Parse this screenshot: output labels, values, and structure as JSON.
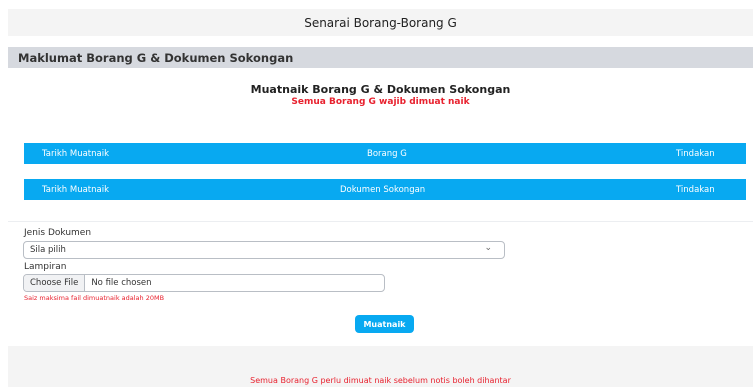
{
  "header": {
    "title": "Senarai Borang-Borang G"
  },
  "section": {
    "title": "Maklumat Borang G & Dokumen Sokongan"
  },
  "upload": {
    "title": "Muatnaik Borang G & Dokumen Sokongan",
    "subtitle": "Semua Borang G wajib dimuat naik"
  },
  "tables": [
    {
      "columns": [
        "Tarikh Muatnaik",
        "Borang G",
        "Tindakan"
      ]
    },
    {
      "columns": [
        "Tarikh Muatnaik",
        "Dokumen Sokongan",
        "Tindakan"
      ]
    }
  ],
  "form": {
    "document_type_label": "Jenis Dokumen",
    "document_type_value": "Sila pilih",
    "attachment_label": "Lampiran",
    "choose_file_label": "Choose File",
    "file_status": "No file chosen",
    "size_hint": "Saiz maksima fail dimuatnaik adalah 20MB",
    "submit_label": "Muatnaik"
  },
  "footer": {
    "note": "Semua Borang G perlu dimuat naik sebelum notis boleh dihantar"
  },
  "colors": {
    "accent": "#08a9f1",
    "warning": "#e8212e"
  },
  "icons": {
    "select_arrow": "chevron-down-icon"
  }
}
